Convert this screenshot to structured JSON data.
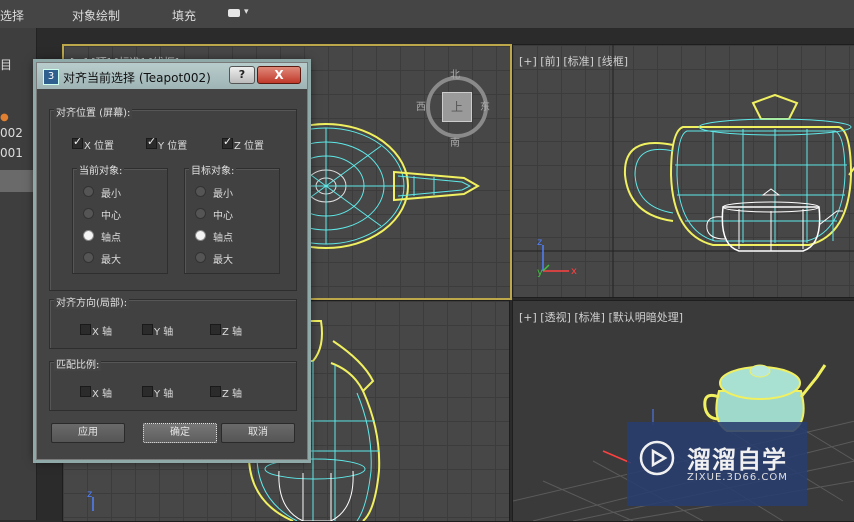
{
  "menu": {
    "item1": "选择",
    "item2": "对象绘制",
    "item3": "填充"
  },
  "left_panel": {
    "partial_label": "目",
    "item1": "002",
    "item2": "001"
  },
  "viewports": {
    "top": {
      "label": "[+] [顶] [标准] [线框]",
      "compass_n": "北",
      "compass_s": "南",
      "compass_e": "东",
      "compass_w": "西",
      "compass_center": "上"
    },
    "front": {
      "label": "[+] [前] [标准] [线框]"
    },
    "persp": {
      "label": "[+] [透视] [标准] [默认明暗处理]"
    }
  },
  "dialog": {
    "icon": "3",
    "title": "对齐当前选择 (Teapot002)",
    "help": "?",
    "close": "X",
    "position_group": {
      "title": "对齐位置 (屏幕):",
      "x": "X 位置",
      "y": "Y 位置",
      "z": "Z 位置",
      "x_checked": true,
      "y_checked": true,
      "z_checked": true,
      "current": {
        "title": "当前对象:",
        "options": [
          "最小",
          "中心",
          "轴点",
          "最大"
        ],
        "selected": "轴点"
      },
      "target": {
        "title": "目标对象:",
        "options": [
          "最小",
          "中心",
          "轴点",
          "最大"
        ],
        "selected": "轴点"
      }
    },
    "orient_group": {
      "title": "对齐方向(局部):",
      "x": "X 轴",
      "y": "Y 轴",
      "z": "Z 轴"
    },
    "scale_group": {
      "title": "匹配比例:",
      "x": "X 轴",
      "y": "Y 轴",
      "z": "Z 轴"
    },
    "buttons": {
      "apply": "应用",
      "ok": "确定",
      "cancel": "取消"
    }
  },
  "watermark": {
    "title": "溜溜自学",
    "url": "ZIXUE.3D66.COM"
  },
  "colors": {
    "wire": "#5fe8e8",
    "highlight": "#f0f060",
    "grid": "#3c3c3c",
    "active_border": "#bca84b"
  }
}
